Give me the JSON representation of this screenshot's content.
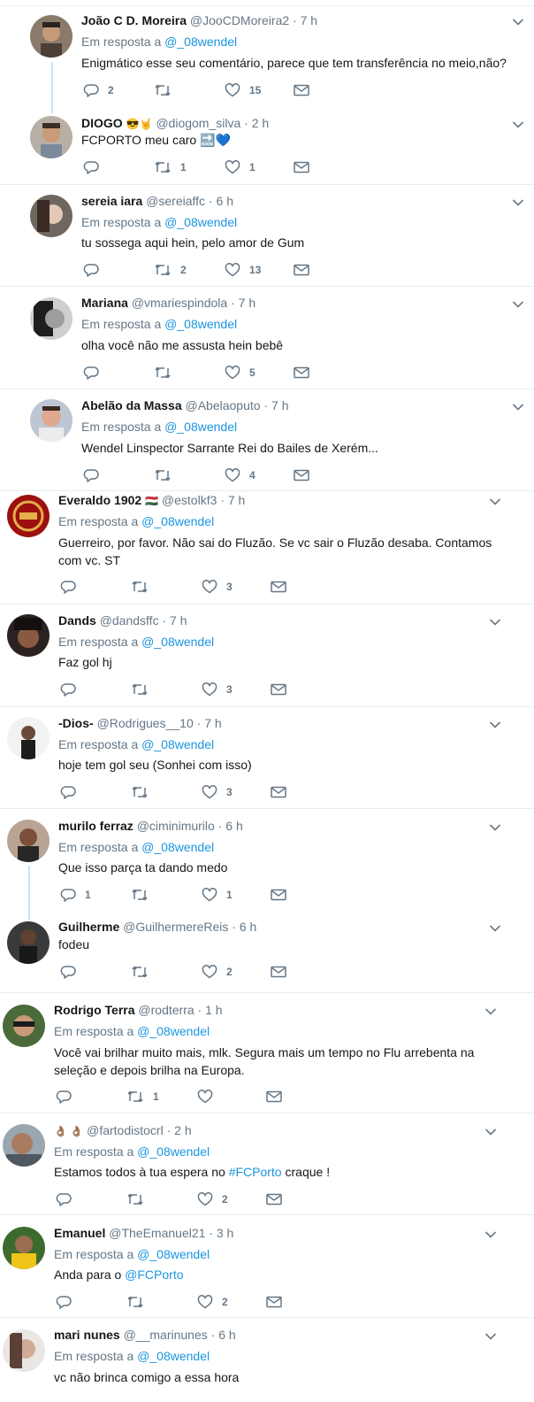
{
  "reply_prefix": "Em resposta a",
  "reply_target": "@_08wendel",
  "tweets": [
    {
      "name": "João C D. Moreira",
      "handle": "@JooCDMoreira2",
      "time": "7 h",
      "emoji": "",
      "reply": true,
      "text": "Enigmático esse seu comentário, parece que tem transferência no meio,não?",
      "replies": "2",
      "retweets": "",
      "likes": "15"
    },
    {
      "name": "DIOGO",
      "handle": "@diogom_silva",
      "time": "2 h",
      "emoji": "😎🤘",
      "reply": false,
      "text": "FCPORTO meu caro 🔜💙",
      "replies": "",
      "retweets": "1",
      "likes": "1"
    },
    {
      "name": "sereia iara",
      "handle": "@sereiaffc",
      "time": "6 h",
      "emoji": "",
      "reply": true,
      "text": "tu sossega aqui hein, pelo amor de Gum",
      "replies": "",
      "retweets": "2",
      "likes": "13"
    },
    {
      "name": "Mariana",
      "handle": "@vmariespindola",
      "time": "7 h",
      "emoji": "",
      "reply": true,
      "text": "olha você não me assusta hein bebê",
      "replies": "",
      "retweets": "",
      "likes": "5"
    },
    {
      "name": "Abelão da Massa",
      "handle": "@Abelaoputo",
      "time": "7 h",
      "emoji": "",
      "reply": true,
      "text": "Wendel Linspector Sarrante Rei do Bailes de Xerém...",
      "replies": "",
      "retweets": "",
      "likes": "4"
    },
    {
      "name": "Everaldo 1902",
      "handle": "@estolkf3",
      "time": "7 h",
      "emoji": "🇭🇺",
      "reply": true,
      "text": "Guerreiro, por favor. Não sai do Fluzão. Se vc sair o Fluzão desaba. Contamos com vc. ST",
      "replies": "",
      "retweets": "",
      "likes": "3"
    },
    {
      "name": "Dands",
      "handle": "@dandsffc",
      "time": "7 h",
      "emoji": "",
      "reply": true,
      "text": "Faz gol hj",
      "replies": "",
      "retweets": "",
      "likes": "3"
    },
    {
      "name": "-Dios-",
      "handle": "@Rodrigues__10",
      "time": "7 h",
      "emoji": "",
      "reply": true,
      "text": "hoje tem gol seu (Sonhei com isso)",
      "replies": "",
      "retweets": "",
      "likes": "3"
    },
    {
      "name": "murilo ferraz",
      "handle": "@ciminimurilo",
      "time": "6 h",
      "emoji": "",
      "reply": true,
      "text": "Que isso parça ta dando medo",
      "replies": "1",
      "retweets": "",
      "likes": "1"
    },
    {
      "name": "Guilherme",
      "handle": "@GuilhermereReis",
      "time": "6 h",
      "emoji": "",
      "reply": false,
      "text": "fodeu",
      "replies": "",
      "retweets": "",
      "likes": "2"
    },
    {
      "name": "Rodrigo Terra",
      "handle": "@rodterra",
      "time": "1 h",
      "emoji": "",
      "reply": true,
      "text": "Você vai brilhar muito mais, mlk. Segura mais um tempo no Flu arrebenta na seleção e depois brilha na Europa.",
      "replies": "",
      "retweets": "1",
      "likes": ""
    },
    {
      "name": "",
      "handle": "@fartodistocrl",
      "time": "2 h",
      "emoji": "👌🏽 👌🏽",
      "reply": true,
      "text_before": "Estamos todos à tua espera no ",
      "text_link": "#FCPorto",
      "text_after": " craque !",
      "replies": "",
      "retweets": "",
      "likes": "2"
    },
    {
      "name": "Emanuel",
      "handle": "@TheEmanuel21",
      "time": "3 h",
      "emoji": "",
      "reply": true,
      "text_before": "Anda para o ",
      "text_link": "@FCPorto",
      "text_after": "",
      "replies": "",
      "retweets": "",
      "likes": "2"
    },
    {
      "name": "mari nunes",
      "handle": "@__marinunes",
      "time": "6 h",
      "emoji": "",
      "reply": true,
      "text": "vc não brinca comigo a essa hora",
      "replies": "",
      "retweets": "",
      "likes": ""
    }
  ],
  "colors": {
    "accent": "#1b95e0",
    "muted": "#657786",
    "thread": "#c4e4fb",
    "divider": "#e6ecf0"
  },
  "icons": {
    "reply": "reply-icon",
    "retweet": "retweet-icon",
    "like": "heart-icon",
    "dm": "envelope-icon",
    "menu": "chevron-down-icon"
  }
}
